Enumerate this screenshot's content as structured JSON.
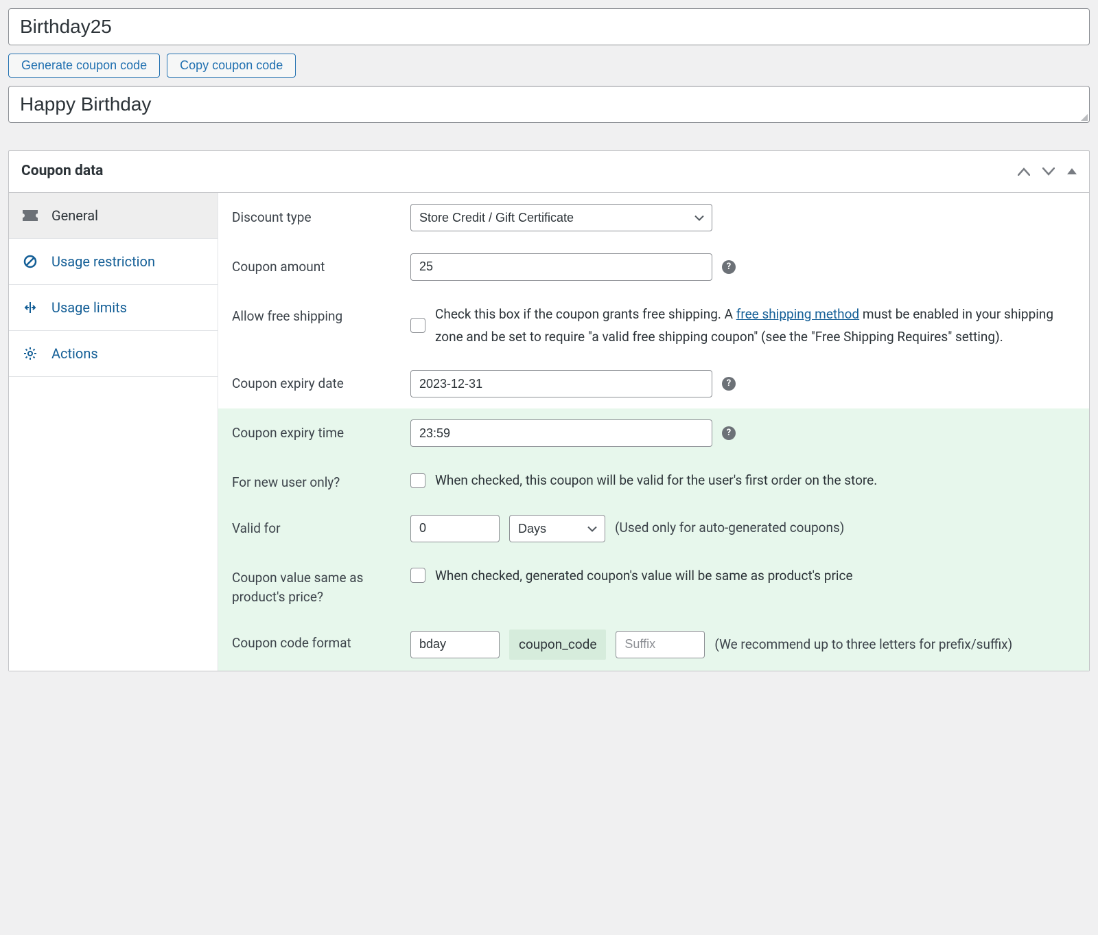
{
  "coupon_code": "Birthday25",
  "buttons": {
    "generate": "Generate coupon code",
    "copy": "Copy coupon code"
  },
  "description": "Happy Birthday",
  "panel": {
    "title": "Coupon data"
  },
  "tabs": [
    {
      "id": "general",
      "label": "General",
      "active": true
    },
    {
      "id": "usage-restriction",
      "label": "Usage restriction",
      "active": false
    },
    {
      "id": "usage-limits",
      "label": "Usage limits",
      "active": false
    },
    {
      "id": "actions",
      "label": "Actions",
      "active": false
    }
  ],
  "fields": {
    "discount_type": {
      "label": "Discount type",
      "value": "Store Credit / Gift Certificate"
    },
    "coupon_amount": {
      "label": "Coupon amount",
      "value": "25"
    },
    "free_shipping": {
      "label": "Allow free shipping",
      "text_before": "Check this box if the coupon grants free shipping. A ",
      "link_text": "free shipping method",
      "text_after": " must be enabled in your shipping zone and be set to require \"a valid free shipping coupon\" (see the \"Free Shipping Requires\" setting)."
    },
    "expiry_date": {
      "label": "Coupon expiry date",
      "value": "2023-12-31"
    },
    "expiry_time": {
      "label": "Coupon expiry time",
      "value": "23:59"
    },
    "new_user": {
      "label": "For new user only?",
      "text": "When checked, this coupon will be valid for the user's first order on the store."
    },
    "valid_for": {
      "label": "Valid for",
      "number": "0",
      "unit": "Days",
      "hint": "(Used only for auto-generated coupons)"
    },
    "same_as_price": {
      "label": "Coupon value same as product's price?",
      "text": "When checked, generated coupon's value will be same as product's price"
    },
    "code_format": {
      "label": "Coupon code format",
      "prefix": "bday",
      "chip": "coupon_code",
      "suffix_placeholder": "Suffix",
      "hint": "(We recommend up to three letters for prefix/suffix)"
    }
  }
}
